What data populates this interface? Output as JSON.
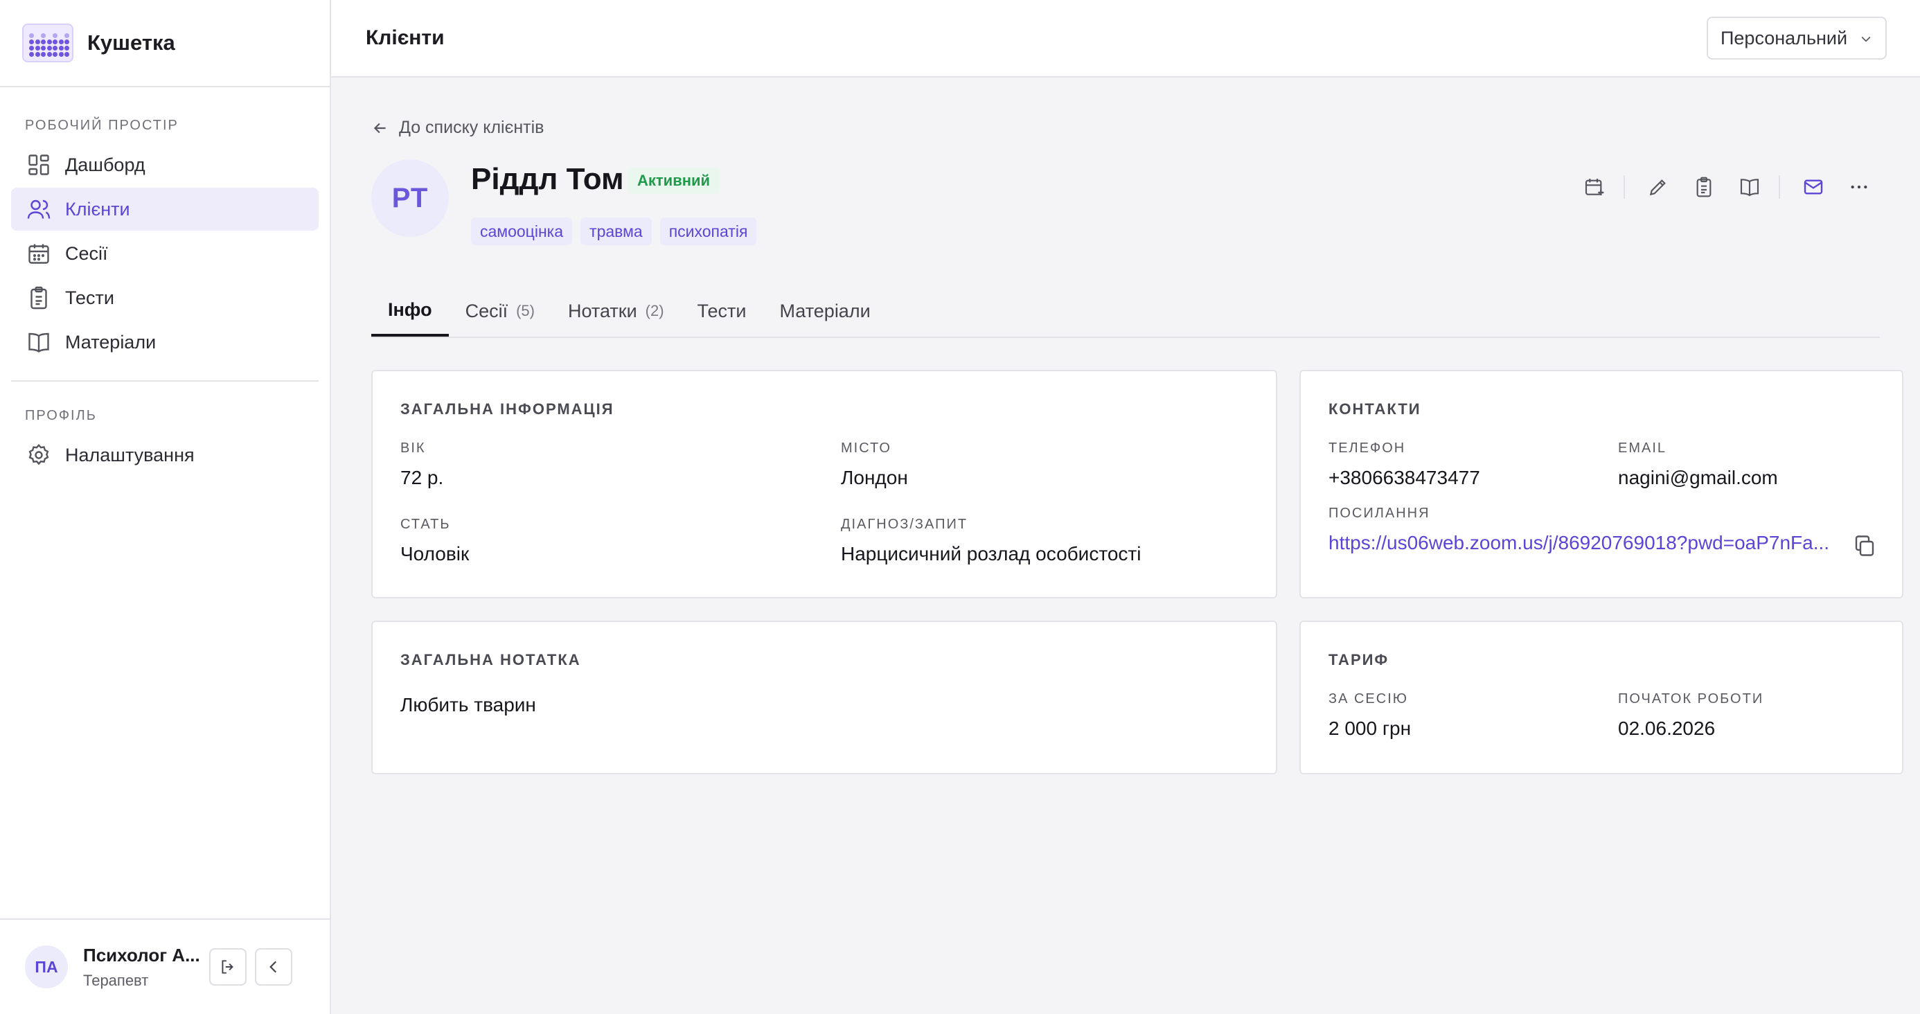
{
  "app": {
    "name": "Кушетка"
  },
  "sidebar": {
    "workspace_section": "РОБОЧИЙ ПРОСТІР",
    "items": [
      {
        "label": "Дашборд",
        "icon": "dashboard-icon",
        "active": false
      },
      {
        "label": "Клієнти",
        "icon": "users-icon",
        "active": true
      },
      {
        "label": "Сесії",
        "icon": "calendar-icon",
        "active": false
      },
      {
        "label": "Тести",
        "icon": "clipboard-icon",
        "active": false
      },
      {
        "label": "Матеріали",
        "icon": "book-icon",
        "active": false
      }
    ],
    "profile_section": "ПРОФІЛЬ",
    "profile_items": [
      {
        "label": "Налаштування",
        "icon": "gear-icon"
      }
    ],
    "user": {
      "initials": "ПА",
      "name": "Психолог А...",
      "role": "Терапевт"
    }
  },
  "header": {
    "title": "Клієнти",
    "workspace_select": "Персональний"
  },
  "client": {
    "back_label": "До списку клієнтів",
    "initials": "РТ",
    "name": "Ріддл Том",
    "status": "Активний",
    "tags": [
      "самооцінка",
      "травма",
      "психопатія"
    ]
  },
  "tabs": [
    {
      "label": "Інфо",
      "count": "",
      "active": true
    },
    {
      "label": "Сесії",
      "count": "(5)",
      "active": false
    },
    {
      "label": "Нотатки",
      "count": "(2)",
      "active": false
    },
    {
      "label": "Тести",
      "count": "",
      "active": false
    },
    {
      "label": "Матеріали",
      "count": "",
      "active": false
    }
  ],
  "general_info": {
    "title": "ЗАГАЛЬНА ІНФОРМАЦІЯ",
    "age_label": "ВІК",
    "age": "72 р.",
    "city_label": "МІСТО",
    "city": "Лондон",
    "gender_label": "СТАТЬ",
    "gender": "Чоловік",
    "diagnosis_label": "ДІАГНОЗ/ЗАПИТ",
    "diagnosis": "Нарцисичний розлад особистості"
  },
  "contacts": {
    "title": "КОНТАКТИ",
    "phone_label": "ТЕЛЕФОН",
    "phone": "+3806638473477",
    "email_label": "EMAIL",
    "email": "nagini@gmail.com",
    "link_label": "ПОСИЛАННЯ",
    "link": "https://us06web.zoom.us/j/86920769018?pwd=oaP7nFa..."
  },
  "note": {
    "title": "ЗАГАЛЬНА НОТАТКА",
    "text": "Любить тварин"
  },
  "tariff": {
    "title": "ТАРИФ",
    "per_session_label": "ЗА СЕСІЮ",
    "per_session": "2 000 грн",
    "start_label": "ПОЧАТОК РОБОТИ",
    "start": "02.06.2026"
  },
  "colors": {
    "accent": "#5b45d6",
    "status_green": "#1f9a4a",
    "tag_bg": "#ecebfb"
  }
}
